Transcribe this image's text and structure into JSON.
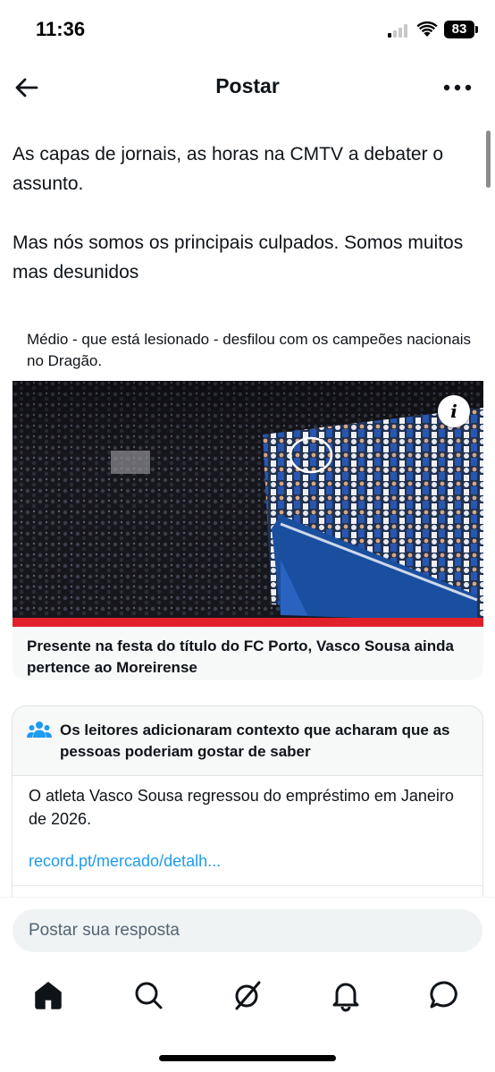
{
  "status_bar": {
    "time": "11:36",
    "battery": "83"
  },
  "header": {
    "title": "Postar",
    "back_icon": "arrow-left-icon",
    "more_icon": "more-horizontal-icon"
  },
  "post": {
    "paragraphs": [
      "As capas de jornais, as horas na CMTV a debater o assunto.",
      "Mas nós somos os principais culpados. Somos muitos mas desunidos"
    ]
  },
  "link_card": {
    "caption": "Médio - que está lesionado - desfilou com os campeões nacionais no Dragão.",
    "headline": "Presente na festa do título do FC Porto, Vasco Sousa ainda pertence ao Moreirense",
    "info_icon": "info-icon"
  },
  "community_note": {
    "title": "Os leitores adicionaram contexto que acharam que as pessoas poderiam gostar de saber",
    "body": "O atleta Vasco Sousa regressou do empréstimo em Janeiro de 2026.",
    "link": "record.pt/mercado/detalh...",
    "icon": "people-icon"
  },
  "reply": {
    "placeholder": "Postar sua resposta"
  },
  "tab_bar": {
    "items": [
      "home-icon",
      "search-icon",
      "grok-icon",
      "bell-icon",
      "message-icon"
    ]
  },
  "colors": {
    "text": "#0f1419",
    "secondary": "#536471",
    "link": "#1d9bf0",
    "note_header_bg": "#f7f9f9",
    "note_icon": "#1d9bf0",
    "porto_blue": "#1a4fa0"
  }
}
